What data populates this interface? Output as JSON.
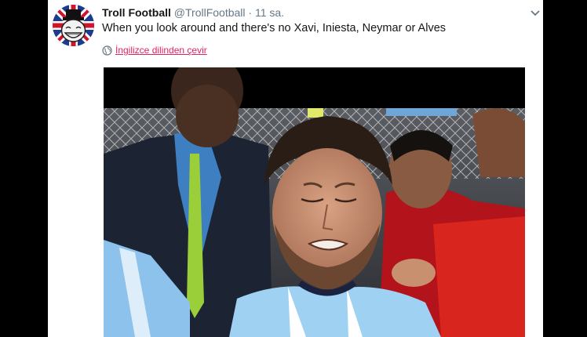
{
  "tweet": {
    "display_name": "Troll Football",
    "handle": "@TrollFootball",
    "separator": "·",
    "timestamp": "11 sa.",
    "text": "When you look around and there's no Xavi, Iniesta, Neymar or Alves",
    "translate_label": "İngilizce dilinden çevir"
  },
  "icons": {
    "avatar": "troll-face-union-jack-avatar",
    "caret": "chevron-down-icon",
    "globe": "globe-icon"
  },
  "colors": {
    "card_bg": "#ffffff",
    "page_bg": "#000000",
    "text_primary": "#14171a",
    "text_secondary": "#657786",
    "translate_link": "#e0245e"
  }
}
